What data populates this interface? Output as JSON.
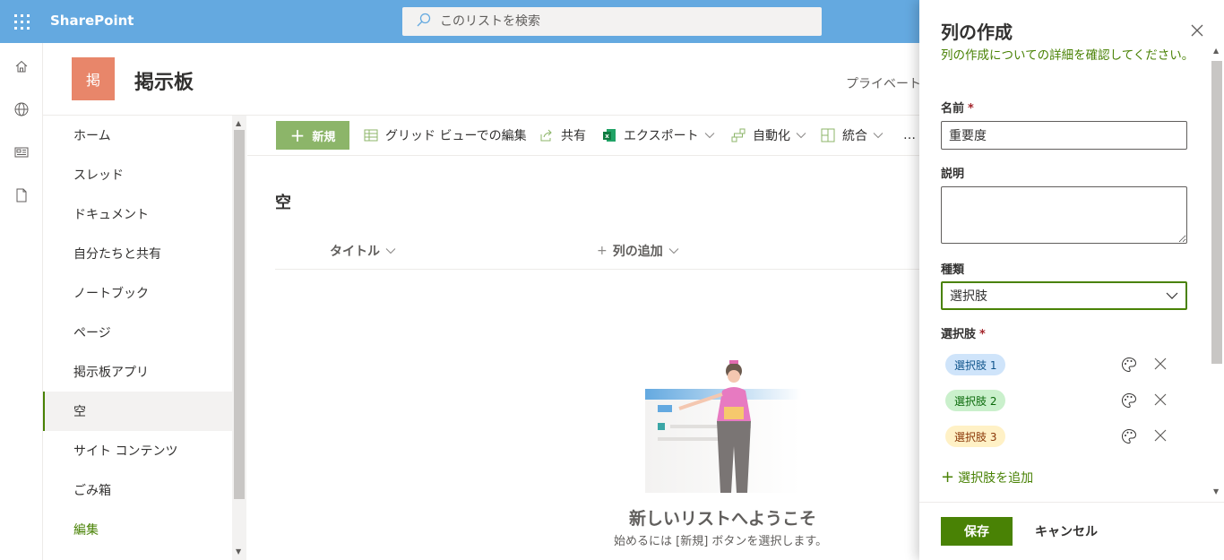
{
  "suite": {
    "brand": "SharePoint",
    "search_placeholder": "このリストを検索"
  },
  "appbar": {
    "icons": [
      "home-icon",
      "globe-icon",
      "news-icon",
      "file-icon"
    ]
  },
  "site": {
    "logo_text": "掲",
    "title": "掲示板",
    "privacy": "プライベート",
    "logo_color": "#e8866a"
  },
  "nav": {
    "items": [
      "ホーム",
      "スレッド",
      "ドキュメント",
      "自分たちと共有",
      "ノートブック",
      "ページ",
      "掲示板アプリ",
      "空",
      "サイト コンテンツ",
      "ごみ箱",
      "編集"
    ],
    "selected": "空"
  },
  "commands": {
    "new": "新規",
    "grid_edit": "グリッド ビューでの編集",
    "share": "共有",
    "export": "エクスポート",
    "automate": "自動化",
    "integrate": "統合",
    "more": "…"
  },
  "list": {
    "title": "空",
    "columns": {
      "title": "タイトル",
      "add_column": "列の追加"
    },
    "empty_title": "新しいリストへようこそ",
    "empty_sub": "始めるには [新規] ボタンを選択します。"
  },
  "panel": {
    "title": "列の作成",
    "desc": "列の作成についての詳細を確認してください。",
    "name_label": "名前",
    "required_mark": "*",
    "name_value": "重要度",
    "desc_label": "説明",
    "desc_value": "",
    "type_label": "種類",
    "type_value": "選択肢",
    "choices_label": "選択肢",
    "choices": [
      {
        "label": "選択肢 1",
        "bg": "#cfe4fa",
        "fg": "#0f548c"
      },
      {
        "label": "選択肢 2",
        "bg": "#caf0cc",
        "fg": "#0b6a0b"
      },
      {
        "label": "選択肢 3",
        "bg": "#fff1c6",
        "fg": "#8a3707"
      }
    ],
    "add_choice": "選択肢を追加",
    "save": "保存",
    "cancel": "キャンセル"
  },
  "colors": {
    "suitebar": "#64a9e0",
    "accent": "#498205",
    "new_button": "#8cb569"
  }
}
